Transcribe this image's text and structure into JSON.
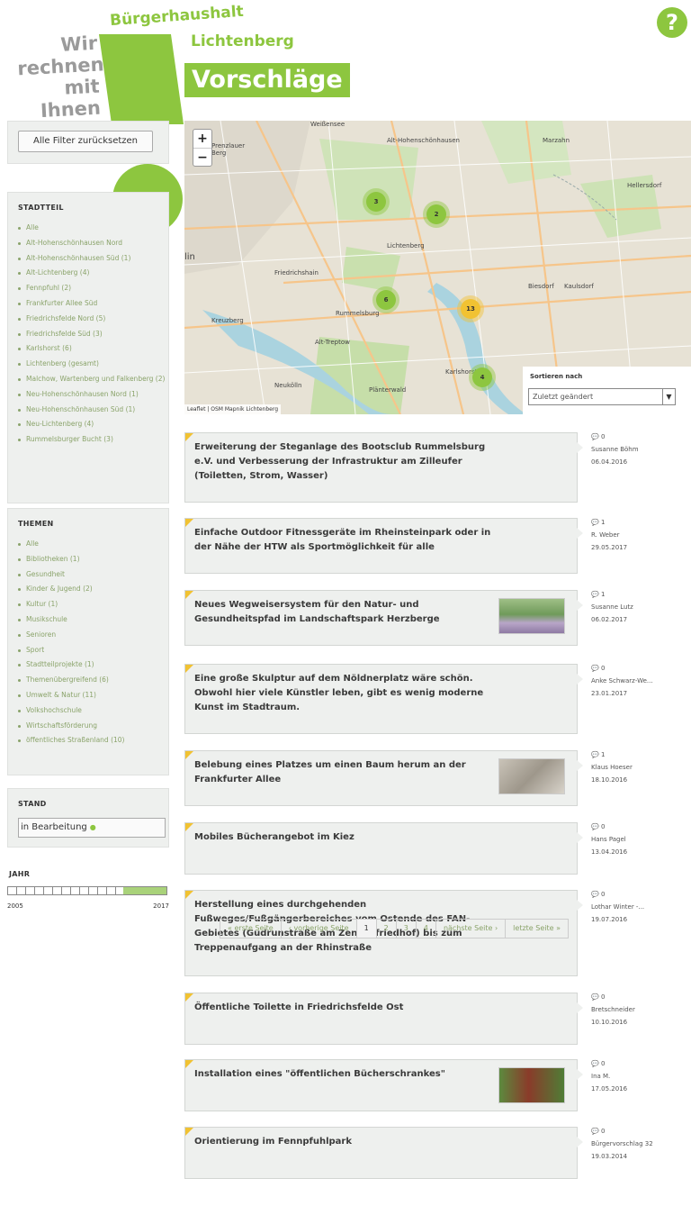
{
  "header": {
    "slogan": "Wir rechnen mit Ihnen",
    "brand_top": "Bürgerhaushalt",
    "brand_sub": "Lichtenberg",
    "page_title": "Vorschläge",
    "help_icon": "?"
  },
  "sidebar": {
    "reset_button": "Alle Filter zurücksetzen",
    "districts_heading": "STADTTEIL",
    "districts": [
      "Alle",
      "Alt-Hohenschönhausen Nord",
      "Alt-Hohenschönhausen Süd (1)",
      "Alt-Lichtenberg (4)",
      "Fennpfuhl (2)",
      "Frankfurter Allee Süd",
      "Friedrichsfelde Nord (5)",
      "Friedrichsfelde Süd (3)",
      "Karlshorst (6)",
      "Lichtenberg (gesamt)",
      "Malchow, Wartenberg und Falkenberg (2)",
      "Neu-Hohenschönhausen Nord (1)",
      "Neu-Hohenschönhausen Süd (1)",
      "Neu-Lichtenberg (4)",
      "Rummelsburger Bucht (3)"
    ],
    "topics_heading": "THEMEN",
    "topics": [
      "Alle",
      "Bibliotheken (1)",
      "Gesundheit",
      "Kinder & Jugend (2)",
      "Kultur (1)",
      "Musikschule",
      "Senioren",
      "Sport",
      "Stadtteilprojekte (1)",
      "Themenübergreifend (6)",
      "Umwelt & Natur (11)",
      "Volkshochschule",
      "Wirtschaftsförderung",
      "öffentliches Straßenland (10)"
    ],
    "status_heading": "STAND",
    "status_value": "in Bearbeitung",
    "year_heading": "JAHR",
    "year_min": "2005",
    "year_max": "2017",
    "year_selected_fraction": 0.27
  },
  "map": {
    "zoom_in": "+",
    "zoom_out": "−",
    "labels": [
      "Weißensee",
      "Alt-Hohenschönhausen",
      "Marzahn",
      "Prenzlauer Berg",
      "Lichtenberg",
      "Friedrichshain",
      "Biesdorf",
      "Kaulsdorf",
      "Rummelsburg",
      "Kreuzberg",
      "Alt-Treptow",
      "Neukölln",
      "Plänterwald",
      "Karlshorst",
      "Hellersdorf",
      "lin"
    ],
    "clusters": [
      {
        "count": "3",
        "color": "green"
      },
      {
        "count": "2",
        "color": "green"
      },
      {
        "count": "6",
        "color": "green"
      },
      {
        "count": "13",
        "color": "yellow"
      },
      {
        "count": "4",
        "color": "green"
      }
    ],
    "attribution": "Leaflet | OSM Mapnik Lichtenberg",
    "sort_label": "Sortieren nach",
    "sort_value": "Zuletzt geändert"
  },
  "proposals": [
    {
      "title": "Erweiterung der Steganlage des Bootsclub Rummelsburg e.V. und Verbesserung der Infrastruktur am Zilleufer (Toiletten, Strom, Wasser)",
      "comments": "0",
      "author": "Susanne Böhm",
      "date": "06.04.2016"
    },
    {
      "title": "Einfache Outdoor Fitnessgeräte im Rheinsteinpark oder in der Nähe der HTW als Sportmöglichkeit für alle",
      "comments": "1",
      "author": "R. Weber",
      "date": "29.05.2017"
    },
    {
      "title": "Neues Wegweisersystem für den Natur- und Gesundheitspfad im Landschaftspark Herzberge",
      "comments": "1",
      "author": "Susanne Lutz",
      "date": "06.02.2017"
    },
    {
      "title": "Eine große Skulptur auf dem Nöldnerplatz wäre schön. Obwohl hier viele Künstler leben, gibt es wenig moderne Kunst im Stadtraum.",
      "comments": "0",
      "author": "Anke Schwarz-We...",
      "date": "23.01.2017"
    },
    {
      "title": "Belebung eines Platzes um einen Baum herum an der Frankfurter Allee",
      "comments": "1",
      "author": "Klaus Hoeser",
      "date": "18.10.2016"
    },
    {
      "title": "Mobiles Bücherangebot im Kiez",
      "comments": "0",
      "author": "Hans Pagel",
      "date": "13.04.2016"
    },
    {
      "title": "Herstellung eines durchgehenden Fußweges/Fußgängerbereiches vom Ostende des FAN-Gebietes (Gudrunstraße am Zentralfriedhof) bis zum Treppenaufgang an der Rhinstraße",
      "comments": "0",
      "author": "Lothar Winter -...",
      "date": "19.07.2016"
    },
    {
      "title": "Öffentliche Toilette in Friedrichsfelde Ost",
      "comments": "0",
      "author": "Bretschneider",
      "date": "10.10.2016"
    },
    {
      "title": "Installation eines \"öffentlichen Bücherschrankes\"",
      "comments": "0",
      "author": "Ina M.",
      "date": "17.05.2016"
    },
    {
      "title": "Orientierung im Fennpfuhlpark",
      "comments": "0",
      "author": "Bürgervorschlag 32",
      "date": "19.03.2014"
    }
  ],
  "pager": {
    "first": "« erste Seite",
    "prev": "‹ vorherige Seite",
    "pages": [
      "1",
      "2",
      "3",
      "4"
    ],
    "next": "nächste Seite ›",
    "last": "letzte Seite »"
  },
  "colors": {
    "accent": "#8dc63f",
    "marker_yellow": "#f1c232",
    "panel": "#eef0ee"
  }
}
